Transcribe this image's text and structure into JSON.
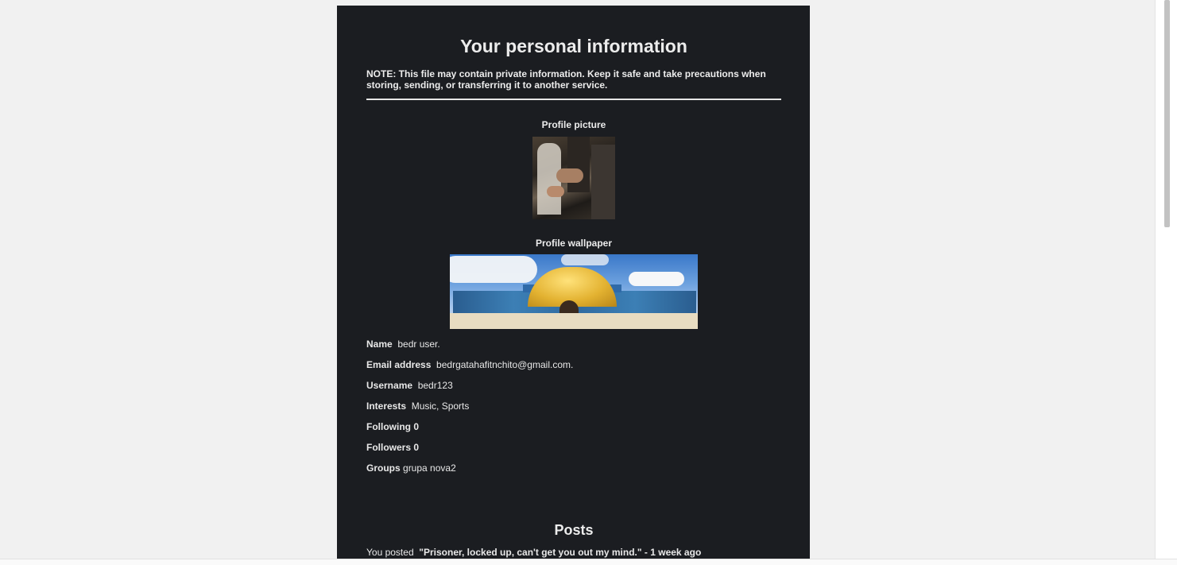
{
  "page": {
    "title": "Your personal information",
    "note": "NOTE: This file may contain private information. Keep it safe and take precautions when storing, sending, or transferring it to another service."
  },
  "profile": {
    "picture_label": "Profile picture",
    "wallpaper_label": "Profile wallpaper",
    "fields": [
      {
        "key": "Name",
        "value": "bedr user."
      },
      {
        "key": "Email address",
        "value": "bedrgatahafitnchito@gmail.com."
      },
      {
        "key": "Username",
        "value": "bedr123"
      },
      {
        "key": "Interests",
        "value": "Music, Sports"
      },
      {
        "key": "Following",
        "value": "0"
      },
      {
        "key": "Followers",
        "value": "0"
      },
      {
        "key": "Groups",
        "value": "grupa nova2"
      }
    ]
  },
  "posts": {
    "title": "Posts",
    "items": [
      {
        "prefix": "You posted",
        "text": "\"Prisoner, locked up, can't get you out my mind.\" - 1 week ago"
      }
    ]
  },
  "colors": {
    "page_background": "#f1f1f1",
    "document_background": "#1b1d21",
    "text": "#e8e8e8"
  }
}
